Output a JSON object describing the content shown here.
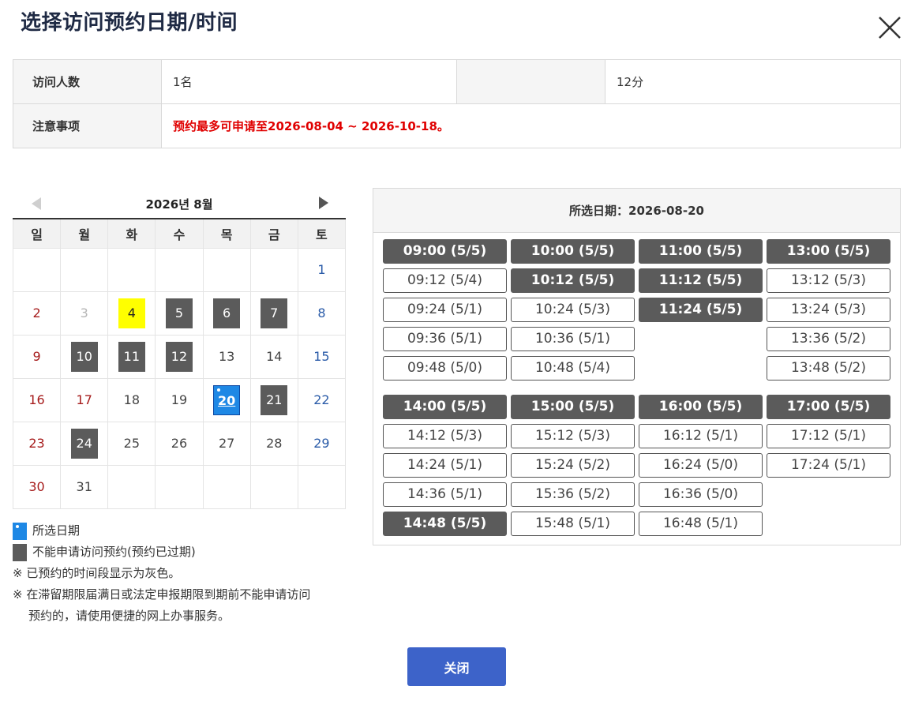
{
  "title": "选择访问预约日期/时间",
  "info": {
    "visitors_label": "访问人数",
    "visitors_value": "1名",
    "duration_value": "12分",
    "notice_label": "注意事项",
    "notice_value": "预约最多可申请至2026-08-04 ~ 2026-10-18。"
  },
  "calendar": {
    "month_label": "2026년 8월",
    "weekdays": [
      "일",
      "월",
      "화",
      "수",
      "목",
      "금",
      "토"
    ],
    "weeks": [
      [
        null,
        null,
        null,
        null,
        null,
        null,
        {
          "d": "1",
          "s": "sat"
        }
      ],
      [
        {
          "d": "2",
          "s": "sun"
        },
        {
          "d": "3",
          "s": "past"
        },
        {
          "d": "4",
          "s": "today"
        },
        {
          "d": "5",
          "s": "blocked"
        },
        {
          "d": "6",
          "s": "blocked"
        },
        {
          "d": "7",
          "s": "blocked"
        },
        {
          "d": "8",
          "s": "sat"
        }
      ],
      [
        {
          "d": "9",
          "s": "sun"
        },
        {
          "d": "10",
          "s": "blocked"
        },
        {
          "d": "11",
          "s": "blocked"
        },
        {
          "d": "12",
          "s": "blocked"
        },
        {
          "d": "13",
          "s": "normal"
        },
        {
          "d": "14",
          "s": "normal"
        },
        {
          "d": "15",
          "s": "sat"
        }
      ],
      [
        {
          "d": "16",
          "s": "sun"
        },
        {
          "d": "17",
          "s": "sun"
        },
        {
          "d": "18",
          "s": "normal"
        },
        {
          "d": "19",
          "s": "normal"
        },
        {
          "d": "20",
          "s": "selected"
        },
        {
          "d": "21",
          "s": "blocked"
        },
        {
          "d": "22",
          "s": "sat"
        }
      ],
      [
        {
          "d": "23",
          "s": "sun"
        },
        {
          "d": "24",
          "s": "blocked"
        },
        {
          "d": "25",
          "s": "normal"
        },
        {
          "d": "26",
          "s": "normal"
        },
        {
          "d": "27",
          "s": "normal"
        },
        {
          "d": "28",
          "s": "normal"
        },
        {
          "d": "29",
          "s": "sat"
        }
      ],
      [
        {
          "d": "30",
          "s": "sun"
        },
        {
          "d": "31",
          "s": "normal"
        },
        null,
        null,
        null,
        null,
        null
      ]
    ]
  },
  "legend": {
    "selected": "所选日期",
    "blocked": "不能申请访问预约(预约已过期)",
    "note1": "※ 已预约的时间段显示为灰色。",
    "note2a": "※ 在滞留期限届满日或法定申报期限到期前不能申请访问",
    "note2b": "预约的，请使用便捷的网上办事服务。"
  },
  "slots": {
    "header": "所选日期：2026-08-20",
    "groups": [
      [
        [
          {
            "t": "09:00 (5/5)",
            "full": true
          },
          {
            "t": "09:12 (5/4)",
            "full": false
          },
          {
            "t": "09:24 (5/1)",
            "full": false
          },
          {
            "t": "09:36 (5/1)",
            "full": false
          },
          {
            "t": "09:48 (5/0)",
            "full": false
          }
        ],
        [
          {
            "t": "10:00 (5/5)",
            "full": true
          },
          {
            "t": "10:12 (5/5)",
            "full": true
          },
          {
            "t": "10:24 (5/3)",
            "full": false
          },
          {
            "t": "10:36 (5/1)",
            "full": false
          },
          {
            "t": "10:48 (5/4)",
            "full": false
          }
        ],
        [
          {
            "t": "11:00 (5/5)",
            "full": true
          },
          {
            "t": "11:12 (5/5)",
            "full": true
          },
          {
            "t": "11:24 (5/5)",
            "full": true
          }
        ],
        [
          {
            "t": "13:00 (5/5)",
            "full": true
          },
          {
            "t": "13:12 (5/3)",
            "full": false
          },
          {
            "t": "13:24 (5/3)",
            "full": false
          },
          {
            "t": "13:36 (5/2)",
            "full": false
          },
          {
            "t": "13:48 (5/2)",
            "full": false
          }
        ]
      ],
      [
        [
          {
            "t": "14:00 (5/5)",
            "full": true
          },
          {
            "t": "14:12 (5/3)",
            "full": false
          },
          {
            "t": "14:24 (5/1)",
            "full": false
          },
          {
            "t": "14:36 (5/1)",
            "full": false
          },
          {
            "t": "14:48 (5/5)",
            "full": true
          }
        ],
        [
          {
            "t": "15:00 (5/5)",
            "full": true
          },
          {
            "t": "15:12 (5/3)",
            "full": false
          },
          {
            "t": "15:24 (5/2)",
            "full": false
          },
          {
            "t": "15:36 (5/2)",
            "full": false
          },
          {
            "t": "15:48 (5/1)",
            "full": false
          }
        ],
        [
          {
            "t": "16:00 (5/5)",
            "full": true
          },
          {
            "t": "16:12 (5/1)",
            "full": false
          },
          {
            "t": "16:24 (5/0)",
            "full": false
          },
          {
            "t": "16:36 (5/0)",
            "full": false
          },
          {
            "t": "16:48 (5/1)",
            "full": false
          }
        ],
        [
          {
            "t": "17:00 (5/5)",
            "full": true
          },
          {
            "t": "17:12 (5/1)",
            "full": false
          },
          {
            "t": "17:24 (5/1)",
            "full": false
          }
        ]
      ]
    ]
  },
  "close_button": "关闭"
}
